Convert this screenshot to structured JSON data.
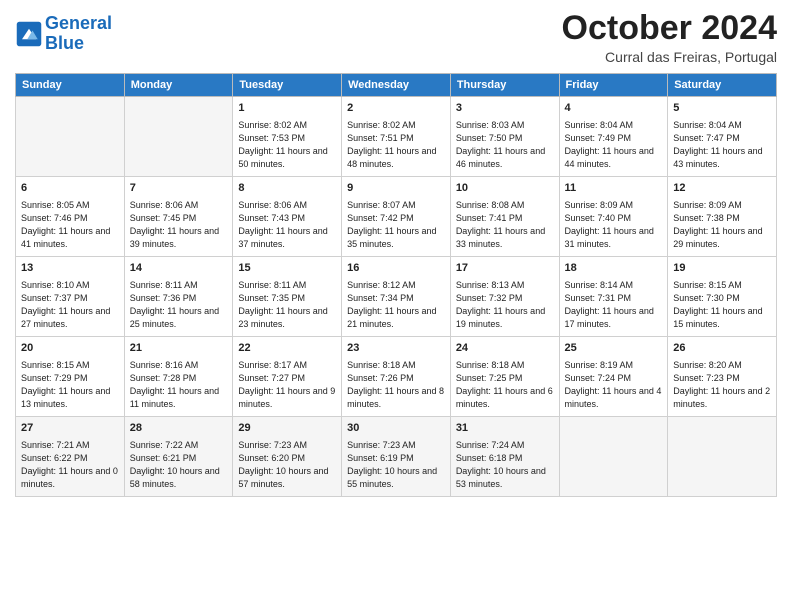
{
  "header": {
    "logo_line1": "General",
    "logo_line2": "Blue",
    "month_title": "October 2024",
    "location": "Curral das Freiras, Portugal"
  },
  "days_of_week": [
    "Sunday",
    "Monday",
    "Tuesday",
    "Wednesday",
    "Thursday",
    "Friday",
    "Saturday"
  ],
  "weeks": [
    [
      {
        "day": "",
        "info": ""
      },
      {
        "day": "",
        "info": ""
      },
      {
        "day": "1",
        "info": "Sunrise: 8:02 AM\nSunset: 7:53 PM\nDaylight: 11 hours and 50 minutes."
      },
      {
        "day": "2",
        "info": "Sunrise: 8:02 AM\nSunset: 7:51 PM\nDaylight: 11 hours and 48 minutes."
      },
      {
        "day": "3",
        "info": "Sunrise: 8:03 AM\nSunset: 7:50 PM\nDaylight: 11 hours and 46 minutes."
      },
      {
        "day": "4",
        "info": "Sunrise: 8:04 AM\nSunset: 7:49 PM\nDaylight: 11 hours and 44 minutes."
      },
      {
        "day": "5",
        "info": "Sunrise: 8:04 AM\nSunset: 7:47 PM\nDaylight: 11 hours and 43 minutes."
      }
    ],
    [
      {
        "day": "6",
        "info": "Sunrise: 8:05 AM\nSunset: 7:46 PM\nDaylight: 11 hours and 41 minutes."
      },
      {
        "day": "7",
        "info": "Sunrise: 8:06 AM\nSunset: 7:45 PM\nDaylight: 11 hours and 39 minutes."
      },
      {
        "day": "8",
        "info": "Sunrise: 8:06 AM\nSunset: 7:43 PM\nDaylight: 11 hours and 37 minutes."
      },
      {
        "day": "9",
        "info": "Sunrise: 8:07 AM\nSunset: 7:42 PM\nDaylight: 11 hours and 35 minutes."
      },
      {
        "day": "10",
        "info": "Sunrise: 8:08 AM\nSunset: 7:41 PM\nDaylight: 11 hours and 33 minutes."
      },
      {
        "day": "11",
        "info": "Sunrise: 8:09 AM\nSunset: 7:40 PM\nDaylight: 11 hours and 31 minutes."
      },
      {
        "day": "12",
        "info": "Sunrise: 8:09 AM\nSunset: 7:38 PM\nDaylight: 11 hours and 29 minutes."
      }
    ],
    [
      {
        "day": "13",
        "info": "Sunrise: 8:10 AM\nSunset: 7:37 PM\nDaylight: 11 hours and 27 minutes."
      },
      {
        "day": "14",
        "info": "Sunrise: 8:11 AM\nSunset: 7:36 PM\nDaylight: 11 hours and 25 minutes."
      },
      {
        "day": "15",
        "info": "Sunrise: 8:11 AM\nSunset: 7:35 PM\nDaylight: 11 hours and 23 minutes."
      },
      {
        "day": "16",
        "info": "Sunrise: 8:12 AM\nSunset: 7:34 PM\nDaylight: 11 hours and 21 minutes."
      },
      {
        "day": "17",
        "info": "Sunrise: 8:13 AM\nSunset: 7:32 PM\nDaylight: 11 hours and 19 minutes."
      },
      {
        "day": "18",
        "info": "Sunrise: 8:14 AM\nSunset: 7:31 PM\nDaylight: 11 hours and 17 minutes."
      },
      {
        "day": "19",
        "info": "Sunrise: 8:15 AM\nSunset: 7:30 PM\nDaylight: 11 hours and 15 minutes."
      }
    ],
    [
      {
        "day": "20",
        "info": "Sunrise: 8:15 AM\nSunset: 7:29 PM\nDaylight: 11 hours and 13 minutes."
      },
      {
        "day": "21",
        "info": "Sunrise: 8:16 AM\nSunset: 7:28 PM\nDaylight: 11 hours and 11 minutes."
      },
      {
        "day": "22",
        "info": "Sunrise: 8:17 AM\nSunset: 7:27 PM\nDaylight: 11 hours and 9 minutes."
      },
      {
        "day": "23",
        "info": "Sunrise: 8:18 AM\nSunset: 7:26 PM\nDaylight: 11 hours and 8 minutes."
      },
      {
        "day": "24",
        "info": "Sunrise: 8:18 AM\nSunset: 7:25 PM\nDaylight: 11 hours and 6 minutes."
      },
      {
        "day": "25",
        "info": "Sunrise: 8:19 AM\nSunset: 7:24 PM\nDaylight: 11 hours and 4 minutes."
      },
      {
        "day": "26",
        "info": "Sunrise: 8:20 AM\nSunset: 7:23 PM\nDaylight: 11 hours and 2 minutes."
      }
    ],
    [
      {
        "day": "27",
        "info": "Sunrise: 7:21 AM\nSunset: 6:22 PM\nDaylight: 11 hours and 0 minutes."
      },
      {
        "day": "28",
        "info": "Sunrise: 7:22 AM\nSunset: 6:21 PM\nDaylight: 10 hours and 58 minutes."
      },
      {
        "day": "29",
        "info": "Sunrise: 7:23 AM\nSunset: 6:20 PM\nDaylight: 10 hours and 57 minutes."
      },
      {
        "day": "30",
        "info": "Sunrise: 7:23 AM\nSunset: 6:19 PM\nDaylight: 10 hours and 55 minutes."
      },
      {
        "day": "31",
        "info": "Sunrise: 7:24 AM\nSunset: 6:18 PM\nDaylight: 10 hours and 53 minutes."
      },
      {
        "day": "",
        "info": ""
      },
      {
        "day": "",
        "info": ""
      }
    ]
  ]
}
